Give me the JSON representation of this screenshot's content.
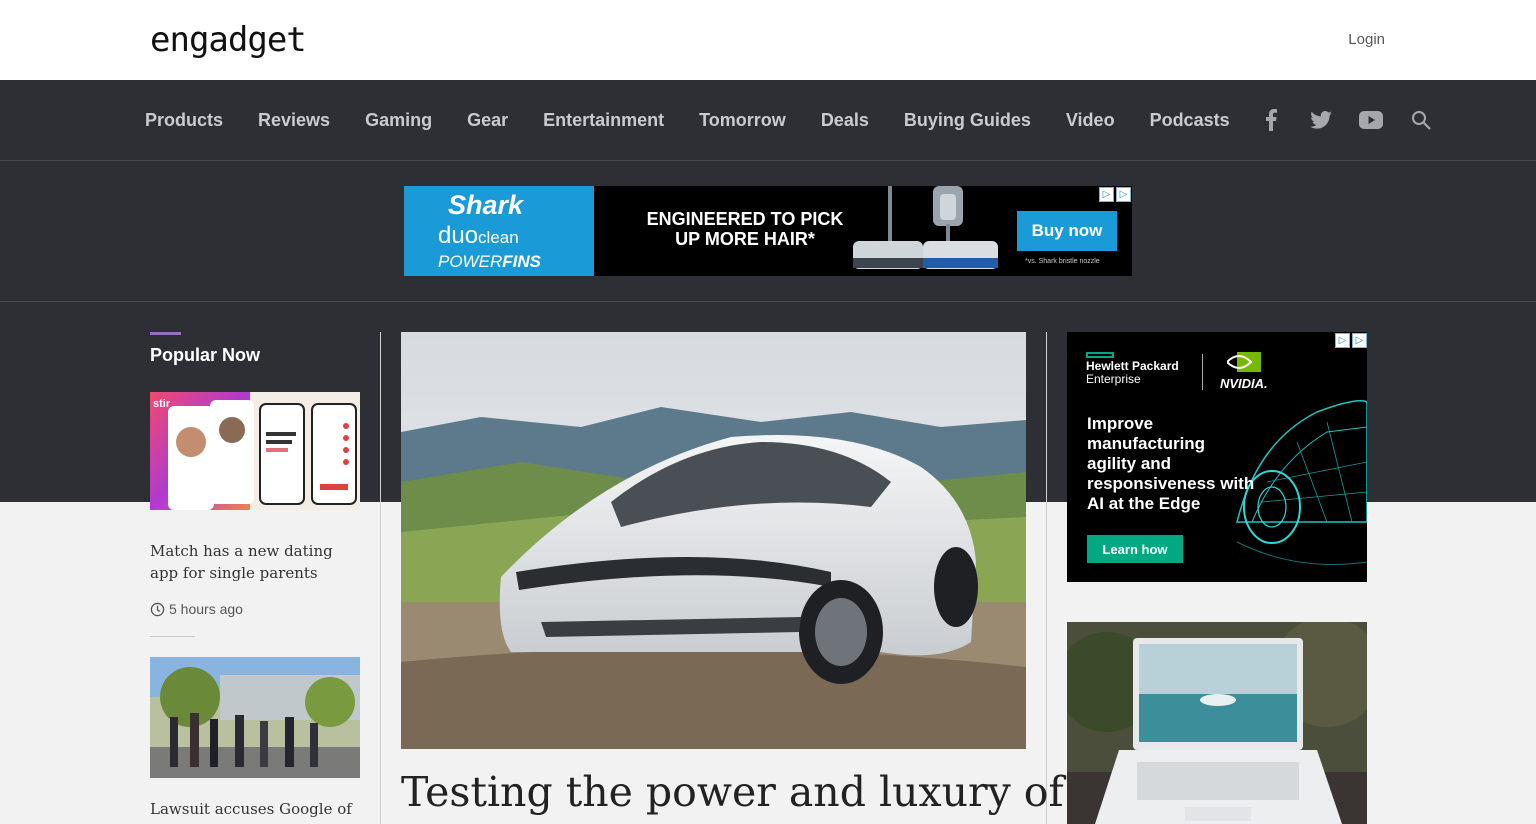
{
  "header": {
    "logo_text": "engadget",
    "login_label": "Login"
  },
  "nav": {
    "items": [
      {
        "label": "Products"
      },
      {
        "label": "Reviews"
      },
      {
        "label": "Gaming"
      },
      {
        "label": "Gear"
      },
      {
        "label": "Entertainment"
      },
      {
        "label": "Tomorrow"
      },
      {
        "label": "Deals"
      },
      {
        "label": "Buying Guides"
      },
      {
        "label": "Video"
      },
      {
        "label": "Podcasts"
      }
    ],
    "icons": [
      "facebook-icon",
      "twitter-icon",
      "youtube-icon",
      "search-icon"
    ]
  },
  "ad_top": {
    "brand": "Shark",
    "product_line1": "duo",
    "product_line1b": "clean",
    "product_line2a": "POWER",
    "product_line2b": "FINS",
    "headline": "ENGINEERED TO PICK UP MORE HAIR*",
    "cta": "Buy now",
    "fineprint": "*vs. Shark bristle nozzle"
  },
  "popular": {
    "title": "Popular Now",
    "items": [
      {
        "title": "Match has a new dating app for single parents",
        "time": "5 hours ago",
        "img_text": "stir"
      },
      {
        "title": "Lawsuit accuses Google of fostering systemic bias against",
        "time": ""
      }
    ]
  },
  "hero": {
    "title": "Testing the power and luxury of"
  },
  "ad_side": {
    "brand1_line1": "Hewlett Packard",
    "brand1_line2": "Enterprise",
    "brand2": "NVIDIA.",
    "copy": "Improve manufacturing agility and responsiveness with AI at the Edge",
    "cta": "Learn how"
  },
  "colors": {
    "nav_bg": "#2d2f34",
    "accent": "#9d6fc2",
    "hpe_green": "#01a982",
    "shark_blue": "#1a9bd7"
  }
}
